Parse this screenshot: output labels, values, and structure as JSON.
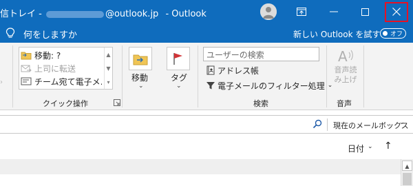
{
  "titlebar": {
    "title_prefix": "信トレイ -",
    "title_email_suffix": "@outlook.jp",
    "title_app": "-  Outlook",
    "bg_color": "#0f6cbd",
    "close_highlight": "#e81123"
  },
  "tellbar": {
    "tell_me": "何をしますか",
    "try_new_outlook": "新しい Outlook を試す",
    "toggle_state": "オフ"
  },
  "ribbon": {
    "quick_steps": {
      "items": [
        {
          "label": "移動: ?",
          "icon": "folder-move-icon",
          "disabled": false
        },
        {
          "label": "上司に転送",
          "icon": "forward-icon",
          "disabled": true
        },
        {
          "label": "チーム宛て電子メ…",
          "icon": "team-mail-icon",
          "disabled": false
        }
      ],
      "group_label": "クイック操作"
    },
    "move": {
      "label": "移動",
      "icon": "move-folder-icon"
    },
    "tags": {
      "label": "タグ",
      "icon": "flag-icon"
    },
    "find": {
      "search_people_placeholder": "ユーザーの検索",
      "address_book": "アドレス帳",
      "filter_email": "電子メールのフィルター処理",
      "group_label": "検索"
    },
    "speech": {
      "read_aloud_line1": "音声読",
      "read_aloud_line2": "み上げ",
      "group_label": "音声"
    }
  },
  "search_row": {
    "scope": "現在のメールボックス"
  },
  "sort_row": {
    "sort_by": "日付"
  }
}
